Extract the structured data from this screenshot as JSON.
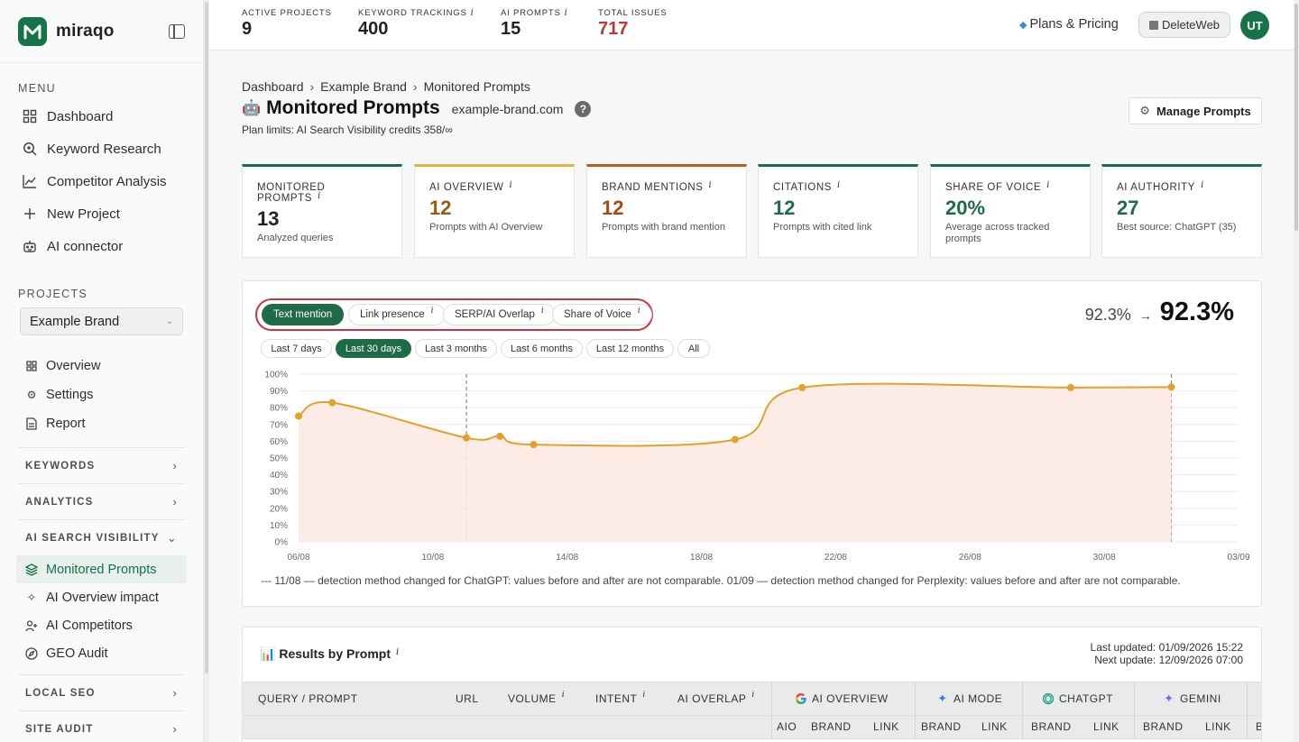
{
  "brand": {
    "name": "miraqo",
    "logo_letter": "M",
    "color": "#157347"
  },
  "sidebar": {
    "menu_title": "MENU",
    "menu": [
      {
        "label": "Dashboard",
        "icon": "grid-icon"
      },
      {
        "label": "Keyword Research",
        "icon": "search-icon"
      },
      {
        "label": "Competitor Analysis",
        "icon": "line-chart-icon"
      },
      {
        "label": "New Project",
        "icon": "plus-icon"
      },
      {
        "label": "AI connector",
        "icon": "robot-icon"
      }
    ],
    "projects_title": "PROJECTS",
    "project_selected": "Example Brand",
    "project_items": [
      {
        "label": "Overview",
        "icon": "grid-icon"
      },
      {
        "label": "Settings",
        "icon": "gear-icon"
      },
      {
        "label": "Report",
        "icon": "document-icon"
      }
    ],
    "groups": {
      "keywords": "KEYWORDS",
      "analytics": "ANALYTICS",
      "ai_search": "AI SEARCH VISIBILITY",
      "local_seo": "LOCAL SEO",
      "site_audit": "SITE AUDIT"
    },
    "ai_items": [
      {
        "label": "Monitored Prompts",
        "icon": "layers-icon",
        "active": true
      },
      {
        "label": "AI Overview impact",
        "icon": "sparkle-icon"
      },
      {
        "label": "AI Competitors",
        "icon": "users-icon"
      },
      {
        "label": "GEO Audit",
        "icon": "compass-icon"
      }
    ]
  },
  "topbar": {
    "stats": [
      {
        "label": "ACTIVE PROJECTS",
        "value": "9",
        "info": ""
      },
      {
        "label": "KEYWORD TRACKINGS",
        "value": "400",
        "info": "i"
      },
      {
        "label": "AI PROMPTS",
        "value": "15",
        "info": "i"
      },
      {
        "label": "TOTAL ISSUES",
        "value": "717",
        "info": ""
      }
    ],
    "plans_label": "Plans & Pricing",
    "workspace_label": "DeleteWeb",
    "avatar_initials": "UT"
  },
  "header": {
    "breadcrumb": [
      "Dashboard",
      "Example Brand",
      "Monitored Prompts"
    ],
    "title": "Monitored Prompts",
    "domain": "example-brand.com",
    "help": "?",
    "plan_limits": "Plan limits: AI Search Visibility credits 358/∞",
    "manage_button": "Manage Prompts"
  },
  "kpis": [
    {
      "label": "MONITORED PROMPTS",
      "value": "13",
      "sub": "Analyzed queries",
      "accent": "#1f6b47",
      "value_color": "#1f2328"
    },
    {
      "label": "AI OVERVIEW",
      "value": "12",
      "sub": "Prompts with AI Overview",
      "accent": "#e2b53a",
      "value_color": "#9a5b12"
    },
    {
      "label": "BRAND MENTIONS",
      "value": "12",
      "sub": "Prompts with brand mention",
      "accent": "#c1581c",
      "value_color": "#a34a17"
    },
    {
      "label": "CITATIONS",
      "value": "12",
      "sub": "Prompts with cited link",
      "accent": "#1f6b47",
      "value_color": "#1f6b47"
    },
    {
      "label": "SHARE OF VOICE",
      "value": "20%",
      "sub": "Average across tracked prompts",
      "accent": "#1f6b47",
      "value_color": "#1f6b47"
    },
    {
      "label": "AI AUTHORITY",
      "value": "27",
      "sub": "Best source: ChatGPT (35)",
      "accent": "#1f6b47",
      "value_color": "#1f6b47"
    }
  ],
  "chart_panel": {
    "metric_tabs": [
      "Text mention",
      "Link presence",
      "SERP/AI Overlap",
      "Share of Voice"
    ],
    "ranges": [
      "Last 7 days",
      "Last 30 days",
      "Last 3 months",
      "Last 6 months",
      "Last 12 months",
      "All"
    ],
    "value_from": "92.3%",
    "arrow": "→",
    "value_to": "92.3%",
    "footnote": "--- 11/08 — detection method changed for ChatGPT: values before and after are not comparable. 01/09 — detection method changed for Perplexity: values before and after are not comparable."
  },
  "chart_data": {
    "type": "area",
    "x_ticks": [
      "06/08",
      "10/08",
      "14/08",
      "18/08",
      "22/08",
      "26/08",
      "30/08",
      "03/09"
    ],
    "y_ticks": [
      "0%",
      "10%",
      "20%",
      "30%",
      "40%",
      "50%",
      "60%",
      "70%",
      "80%",
      "90%",
      "100%"
    ],
    "ylim": [
      0,
      100
    ],
    "x_range_days": [
      6,
      34
    ],
    "series": [
      {
        "color": "#e0a12d",
        "points": [
          {
            "x": 6,
            "y": 75
          },
          {
            "x": 7,
            "y": 83
          },
          {
            "x": 11,
            "y": 62
          },
          {
            "x": 12,
            "y": 63
          },
          {
            "x": 13,
            "y": 58
          },
          {
            "x": 19,
            "y": 61
          },
          {
            "x": 21,
            "y": 92
          },
          {
            "x": 29,
            "y": 92
          },
          {
            "x": 32,
            "y": 92.3
          }
        ]
      }
    ],
    "annotations": [
      {
        "x": 11,
        "label": "11/08"
      },
      {
        "x": 32,
        "label": "01/09"
      }
    ],
    "grid": true
  },
  "results": {
    "title": "Results by Prompt",
    "updated": "Last updated: 01/09/2026 15:22",
    "next_update": "Next update: 12/09/2026 07:00",
    "columns": [
      "QUERY / PROMPT",
      "URL",
      "VOLUME",
      "INTENT",
      "AI OVERLAP"
    ],
    "providers": [
      "AI OVERVIEW",
      "AI MODE",
      "CHATGPT",
      "GEMINI"
    ],
    "sub_columns": [
      "AIO",
      "BRAND",
      "LINK",
      "BRAND",
      "LINK",
      "BRAND",
      "LINK",
      "BRAND",
      "LINK",
      "B"
    ]
  }
}
